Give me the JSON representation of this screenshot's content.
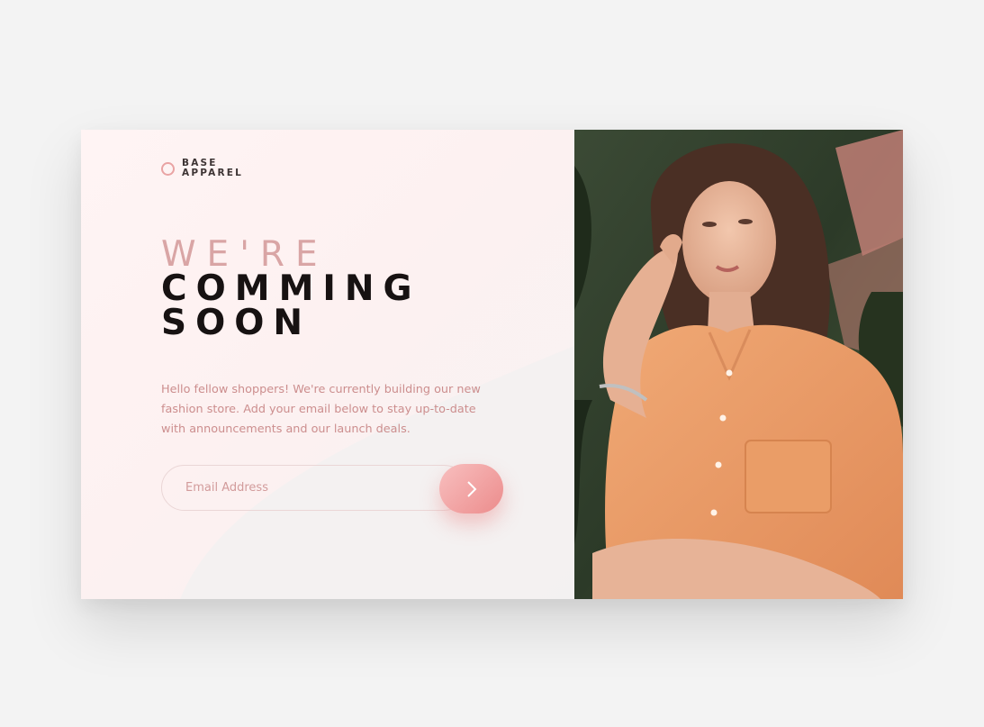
{
  "brand": {
    "line1": "BASE",
    "line2": "APPAREL"
  },
  "headline": {
    "light": "WE'RE",
    "dark_line1": "COMMING",
    "dark_line2": "SOON"
  },
  "description": "Hello fellow shoppers! We're currently building our new fashion store. Add your email below to stay up-to-date with announcements and our launch deals.",
  "form": {
    "email_placeholder": "Email Address",
    "email_value": ""
  },
  "icons": {
    "logo": "ring-logo-icon",
    "submit": "chevron-right-icon"
  },
  "colors": {
    "accent": "#ce9797",
    "button_from": "#f8bfbf",
    "button_to": "#ec8c8c",
    "heading_dark": "#171212",
    "background": "#f3f3f3"
  }
}
